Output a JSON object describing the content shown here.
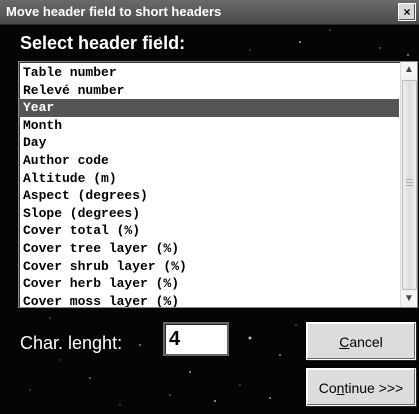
{
  "window": {
    "title": "Move header field to short headers",
    "close_label": "×"
  },
  "heading": "Select header field:",
  "fields": {
    "items": [
      "Table number",
      "Relevé number",
      "Year",
      "Month",
      "Day",
      "Author code",
      "Altitude (m)",
      "Aspect (degrees)",
      "Slope (degrees)",
      "Cover total (%)",
      "Cover tree layer (%)",
      "Cover shrub layer (%)",
      "Cover herb layer (%)",
      "Cover moss layer (%)"
    ],
    "selected": "Year"
  },
  "char_length": {
    "label": "Char. lenght:",
    "value": "4"
  },
  "buttons": {
    "cancel_mnemonic": "C",
    "cancel_rest": "ancel",
    "continue_pre": "Co",
    "continue_mnemonic": "n",
    "continue_rest": "tinue >>>"
  }
}
